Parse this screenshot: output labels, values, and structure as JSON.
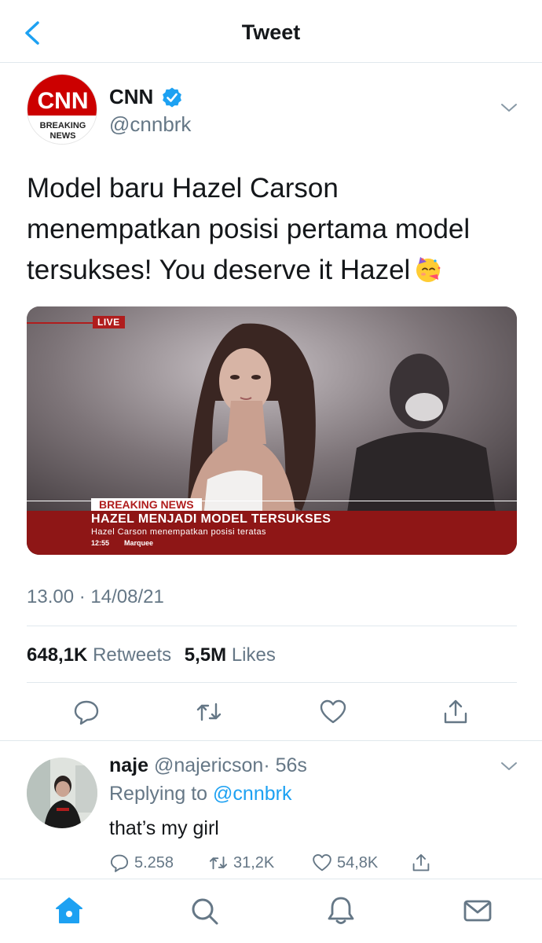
{
  "header": {
    "title": "Tweet"
  },
  "tweet": {
    "author_name": "CNN",
    "handle": "@cnnbrk",
    "avatar": {
      "logo_text": "CNN",
      "badge_line1": "BREAKING",
      "badge_line2": "NEWS"
    },
    "text": "Model baru Hazel Carson menempatkan posisi pertama model tersukses! You deserve it Hazel",
    "emoji": "partying-face-emoji",
    "media": {
      "live": "LIVE",
      "breaking_label": "BREAKING NEWS",
      "headline": "HAZEL MENJADI MODEL TERSUKSES",
      "subheadline": "Hazel Carson menempatkan posisi teratas",
      "time": "12:55",
      "marquee": "Marquee"
    },
    "timestamp": "13.00 · 14/08/21",
    "retweets_count": "648,1K",
    "retweets_label": "Retweets",
    "likes_count": "5,5M",
    "likes_label": "Likes"
  },
  "reply": {
    "name": "naje",
    "handle": "@najericson",
    "time": "· 56s",
    "replying_prefix": "Replying to",
    "replying_to": "@cnnbrk",
    "text": "that’s my girl",
    "replies": "5.258",
    "retweets": "31,2K",
    "likes": "54,8K"
  },
  "colors": {
    "accent": "#1da1f2",
    "text": "#14171a",
    "secondary": "#657786",
    "cnn_red": "#cc0000",
    "ticker_red": "#8e1616"
  },
  "icons": [
    "back-chevron-icon",
    "verified-badge-icon",
    "chevron-down-icon",
    "reply-icon",
    "retweet-icon",
    "like-icon",
    "share-icon",
    "home-icon",
    "search-icon",
    "notifications-icon",
    "messages-icon"
  ]
}
